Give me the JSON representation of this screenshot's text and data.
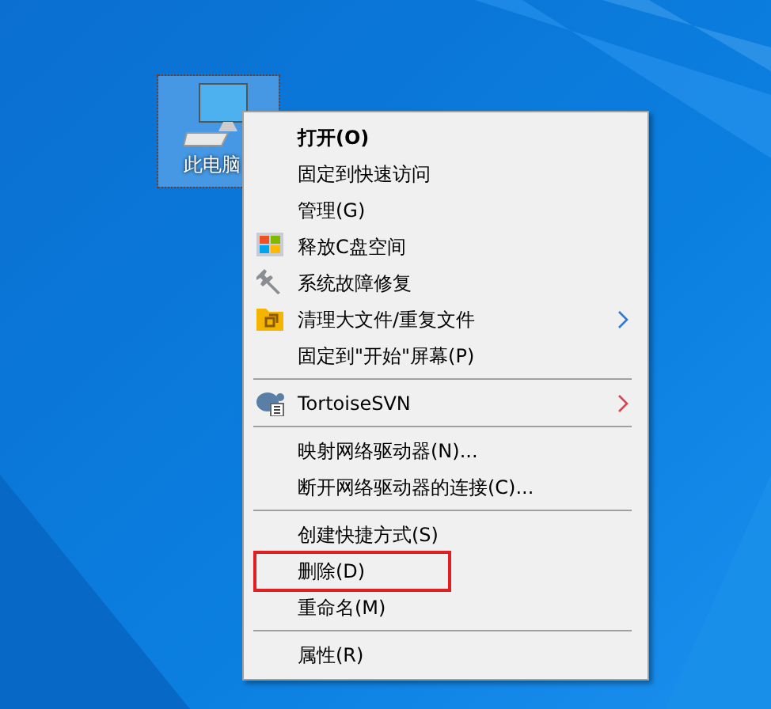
{
  "desktop": {
    "icons": [
      {
        "label": "此电脑",
        "selected": true
      }
    ]
  },
  "context_menu": {
    "items": [
      {
        "kind": "item",
        "label": "打开(O)",
        "default": true,
        "submenu": false,
        "highlighted": false
      },
      {
        "kind": "item",
        "label": "固定到快速访问",
        "default": false,
        "submenu": false,
        "highlighted": false
      },
      {
        "kind": "item",
        "label": "管理(G)",
        "default": false,
        "submenu": false,
        "highlighted": false
      },
      {
        "kind": "item",
        "label": "释放C盘空间",
        "default": false,
        "submenu": false,
        "highlighted": false
      },
      {
        "kind": "item",
        "label": "系统故障修复",
        "default": false,
        "submenu": false,
        "highlighted": false
      },
      {
        "kind": "item",
        "label": "清理大文件/重复文件",
        "default": false,
        "submenu": true,
        "color": "#2b7bd6",
        "highlighted": false
      },
      {
        "kind": "item",
        "label": "固定到\"开始\"屏幕(P)",
        "default": false,
        "submenu": false,
        "highlighted": false
      },
      {
        "kind": "separator"
      },
      {
        "kind": "item",
        "label": "TortoiseSVN",
        "default": false,
        "submenu": true,
        "color": "#d9434d",
        "highlighted": false
      },
      {
        "kind": "separator"
      },
      {
        "kind": "item",
        "label": "映射网络驱动器(N)...",
        "default": false,
        "submenu": false,
        "highlighted": false
      },
      {
        "kind": "item",
        "label": "断开网络驱动器的连接(C)...",
        "default": false,
        "submenu": false,
        "highlighted": false
      },
      {
        "kind": "separator"
      },
      {
        "kind": "item",
        "label": "创建快捷方式(S)",
        "default": false,
        "submenu": false,
        "highlighted": false
      },
      {
        "kind": "item",
        "label": "删除(D)",
        "default": false,
        "submenu": false,
        "highlighted": true
      },
      {
        "kind": "item",
        "label": "重命名(M)",
        "default": false,
        "submenu": false,
        "highlighted": false
      },
      {
        "kind": "separator"
      },
      {
        "kind": "item",
        "label": "属性(R)",
        "default": false,
        "submenu": false,
        "highlighted": false
      }
    ]
  }
}
